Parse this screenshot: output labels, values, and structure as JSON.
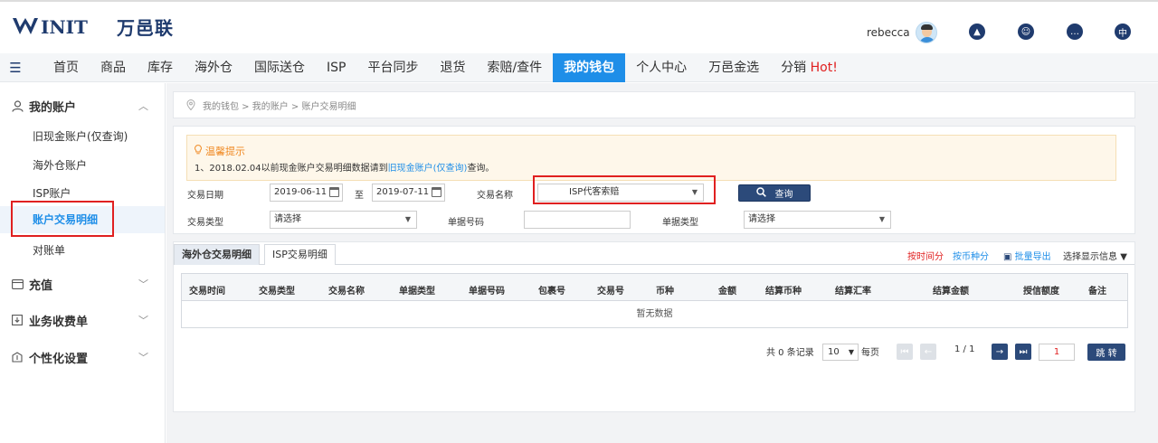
{
  "brand": {
    "logo_text": "INIT",
    "logo_cn": "万邑联"
  },
  "user": {
    "name": "rebecca"
  },
  "nav": {
    "items": [
      "首页",
      "商品",
      "库存",
      "海外仓",
      "国际送仓",
      "ISP",
      "平台同步",
      "退货",
      "索赔/查件",
      "我的钱包",
      "个人中心",
      "万邑金选",
      "分销"
    ],
    "active": "我的钱包",
    "hot_label": "Hot!"
  },
  "sidebar": {
    "my_account": "我的账户",
    "sub_items": [
      "旧现金账户(仅查询)",
      "海外仓账户",
      "ISP账户",
      "账户交易明细",
      "对账单"
    ],
    "active_sub": "账户交易明细",
    "recharge": "充值",
    "fee_bill": "业务收费单",
    "personal": "个性化设置"
  },
  "breadcrumb": "我的钱包 > 我的账户 > 账户交易明细",
  "tip": {
    "title": "温馨提示",
    "text_prefix": "1、2018.02.04以前现金账户交易明细数据请到",
    "link": "旧现金账户(仅查询)",
    "text_suffix": "查询。"
  },
  "form": {
    "trade_date_label": "交易日期",
    "date_from": "2019-06-11",
    "to_label": "至",
    "date_to": "2019-07-11",
    "trade_name_label": "交易名称",
    "trade_name_value": "ISP代客索赔",
    "query_button": "查询",
    "trade_type_label": "交易类型",
    "trade_type_value": "请选择",
    "doc_no_label": "单据号码",
    "doc_no_value": "",
    "doc_type_label": "单据类型",
    "doc_type_value": "请选择"
  },
  "results": {
    "tabs": [
      "海外仓交易明细",
      "ISP交易明细"
    ],
    "active_tab": "海外仓交易明细",
    "by_time": "按时间分",
    "by_currency": "按币种分",
    "batch_export": "批量导出",
    "choose_display": "选择显示信息",
    "columns": [
      "交易时间",
      "交易类型",
      "交易名称",
      "单据类型",
      "单据号码",
      "包裹号",
      "交易号",
      "币种",
      "金额",
      "结算币种",
      "结算汇率",
      "结算金额",
      "授信额度",
      "备注"
    ],
    "empty_text": "暂无数据"
  },
  "pagination": {
    "summary": "共 0 条记录",
    "page_size": "10",
    "per_page": "每页",
    "page_info": "1 / 1",
    "page_input": "1",
    "jump_button": "跳 转"
  },
  "colors": {
    "primary": "#1e8ee8",
    "dark_blue": "#2c4a7a",
    "highlight_red": "#e02020",
    "tip_orange": "#f08a24"
  }
}
